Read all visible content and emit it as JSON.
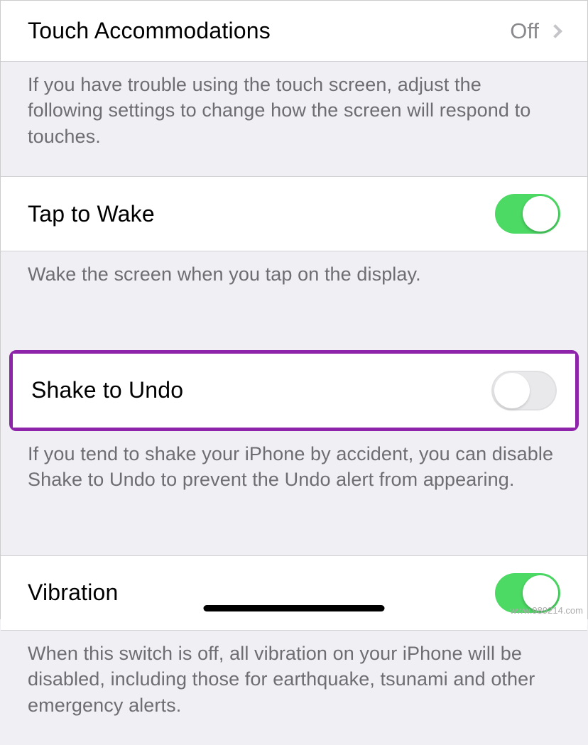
{
  "settings": {
    "touch_accommodations": {
      "label": "Touch Accommodations",
      "value": "Off",
      "footer": "If you have trouble using the touch screen, adjust the following settings to change how the screen will respond to touches."
    },
    "tap_to_wake": {
      "label": "Tap to Wake",
      "footer": "Wake the screen when you tap on the display."
    },
    "shake_to_undo": {
      "label": "Shake to Undo",
      "footer": "If you tend to shake your iPhone by accident, you can disable Shake to Undo to prevent the Undo alert from appearing."
    },
    "vibration": {
      "label": "Vibration",
      "footer": "When this switch is off, all vibration on your iPhone will be disabled, including those for earthquake, tsunami and other emergency alerts."
    }
  },
  "watermark": "www.989214.com"
}
